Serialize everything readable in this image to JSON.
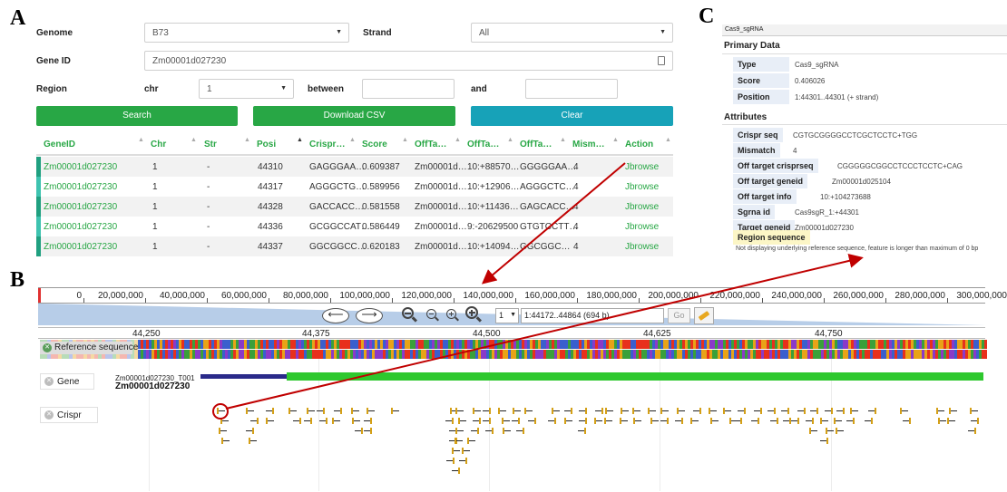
{
  "panels": {
    "a": "A",
    "b": "B",
    "c": "C"
  },
  "form": {
    "genome_label": "Genome",
    "genome_value": "B73",
    "strand_label": "Strand",
    "strand_value": "All",
    "geneid_label": "Gene ID",
    "geneid_value": "Zm00001d027230",
    "region_label": "Region",
    "chr_label": "chr",
    "chr_value": "1",
    "between_label": "between",
    "and_label": "and",
    "search_label": "Search",
    "download_label": "Download CSV",
    "clear_label": "Clear"
  },
  "table": {
    "headers": [
      "GeneID",
      "Chr",
      "Str",
      "Posi",
      "Crispr…",
      "Score",
      "OffTa…",
      "OffTa…",
      "OffTa…",
      "Mism…",
      "Action"
    ],
    "rows": [
      [
        "Zm00001d027230",
        "1",
        "-",
        "44310",
        "GAGGGAA…",
        "0.609387",
        "Zm00001d…",
        "10:+88570…",
        "GGGGGAA…",
        "4",
        "Jbrowse"
      ],
      [
        "Zm00001d027230",
        "1",
        "-",
        "44317",
        "AGGGCTG…",
        "0.589956",
        "Zm00001d…",
        "10:+12906…",
        "AGGGCTC…",
        "4",
        "Jbrowse"
      ],
      [
        "Zm00001d027230",
        "1",
        "-",
        "44328",
        "GACCACC…",
        "0.581558",
        "Zm00001d…",
        "10:+11436…",
        "GAGCACC…",
        "4",
        "Jbrowse"
      ],
      [
        "Zm00001d027230",
        "1",
        "-",
        "44336",
        "GCGGCCAT…",
        "0.586449",
        "Zm00001d…",
        "9:-20629500",
        "GTGTCCTT…",
        "4",
        "Jbrowse"
      ],
      [
        "Zm00001d027230",
        "1",
        "-",
        "44337",
        "GGCGGCC…",
        "0.620183",
        "Zm00001d…",
        "10:+14094…",
        "GGCGGC…",
        "4",
        "Jbrowse"
      ]
    ]
  },
  "detail": {
    "title": "Cas9_sgRNA",
    "primary_heading": "Primary Data",
    "primary": [
      {
        "key": "Type",
        "value": "Cas9_sgRNA"
      },
      {
        "key": "Score",
        "value": "0.406026"
      },
      {
        "key": "Position",
        "value": "1:44301..44301 (+ strand)"
      }
    ],
    "attributes_heading": "Attributes",
    "attributes": [
      {
        "key": "Crispr seq",
        "value": "CGTGCGGGGCCTCGCTCCTC+TGG"
      },
      {
        "key": "Mismatch",
        "value": "4"
      },
      {
        "key": "Off target crisprseq",
        "value": "CGGGGGCGGCCTCCCTCCTC+CAG"
      },
      {
        "key": "Off target geneid",
        "value": "Zm00001d025104"
      },
      {
        "key": "Off target info",
        "value": "10:+104273688"
      },
      {
        "key": "Sgrna id",
        "value": "Cas9sgR_1:+44301"
      },
      {
        "key": "Target geneid",
        "value": "Zm00001d027230"
      }
    ],
    "region_key": "Region sequence",
    "region_note": "Not displaying underlying reference sequence, feature is longer than maximum of 0 bp"
  },
  "browser": {
    "ruler_labels": [
      "0",
      "20,000,000",
      "40,000,000",
      "60,000,000",
      "80,000,000",
      "100,000,000",
      "120,000,000",
      "140,000,000",
      "160,000,000",
      "180,000,000",
      "200,000,000",
      "220,000,000",
      "240,000,000",
      "260,000,000",
      "280,000,000",
      "300,000,000"
    ],
    "ref_select": "1",
    "location": "1:44172..44864 (694 b)",
    "go_label": "Go",
    "scale_labels": [
      "44,250",
      "44,375",
      "44,500",
      "44,625",
      "44,750"
    ],
    "refseq_track": "Reference sequence",
    "gene_track": "Gene",
    "crispr_track": "Crispr",
    "gene_transcript": "Zm00001d027230_T001",
    "gene_name": "Zm00001d027230"
  },
  "colors": {
    "green": "#28a745",
    "teal": "#17a2b8",
    "arrow": "#c00000",
    "gene_dark": "#2a2a8a",
    "gene_green": "#2ec82e",
    "crispr": "#d4a017"
  },
  "icons": [
    "chevron-down-icon",
    "calendar-icon",
    "sort-icon",
    "arrow-left-icon",
    "arrow-right-icon",
    "zoom-out-icon",
    "zoom-in-icon",
    "highlight-icon",
    "close-icon"
  ]
}
